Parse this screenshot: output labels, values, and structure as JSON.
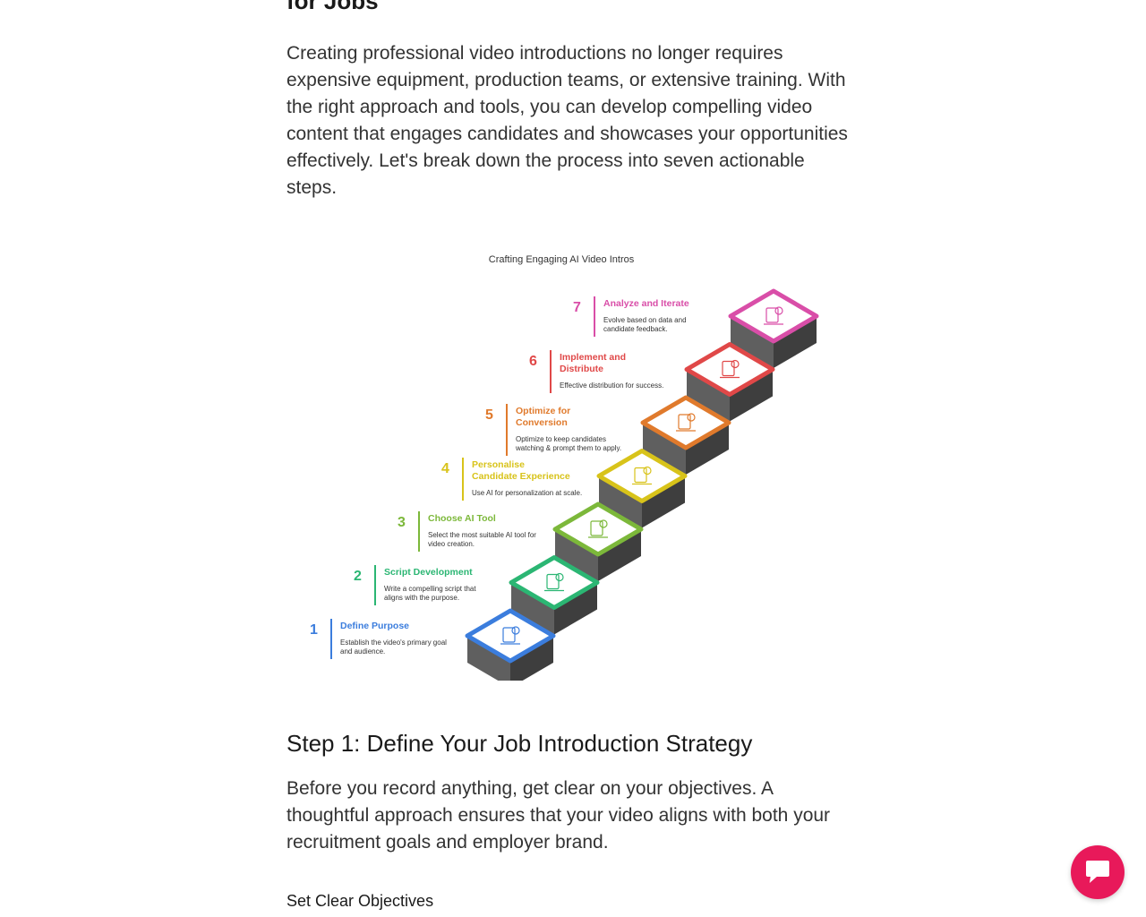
{
  "article": {
    "section_heading": "for Jobs",
    "intro_paragraph": "Creating professional video introductions no longer requires expensive equipment, production teams, or extensive training. With the right approach and tools, you can develop compelling video content that engages candidates and showcases your opportunities effectively. Let's break down the process into seven actionable steps.",
    "infographic": {
      "title": "Crafting Engaging AI Video Intros",
      "steps": [
        {
          "number": "1",
          "title_lines": [
            "Define Purpose"
          ],
          "desc_lines": [
            "Establish the video's primary goal",
            "and audience."
          ],
          "color": "#3b7ddd",
          "icon": "user-target-icon"
        },
        {
          "number": "2",
          "title_lines": [
            "Script Development"
          ],
          "desc_lines": [
            "Write a compelling script that",
            "aligns with the purpose."
          ],
          "color": "#2bb673",
          "icon": "script-file-icon"
        },
        {
          "number": "3",
          "title_lines": [
            "Choose AI Tool"
          ],
          "desc_lines": [
            "Select the most suitable AI tool for",
            "video creation."
          ],
          "color": "#7cb83a",
          "icon": "ai-tool-icon"
        },
        {
          "number": "4",
          "title_lines": [
            "Personalise",
            "Candidate Experience"
          ],
          "desc_lines": [
            "Use AI for personalization at scale."
          ],
          "color": "#d8c31a",
          "icon": "personalise-icon"
        },
        {
          "number": "5",
          "title_lines": [
            "Optimize for",
            "Conversion"
          ],
          "desc_lines": [
            "Optimize to keep candidates",
            "watching & prompt them to apply."
          ],
          "color": "#e07a2c",
          "icon": "optimize-icon"
        },
        {
          "number": "6",
          "title_lines": [
            "Implement and",
            "Distribute"
          ],
          "desc_lines": [
            "Effective distribution for success."
          ],
          "color": "#e04848",
          "icon": "distribute-icon"
        },
        {
          "number": "7",
          "title_lines": [
            "Analyze and Iterate"
          ],
          "desc_lines": [
            "Evolve based on data and",
            "candidate feedback."
          ],
          "color": "#d94ea8",
          "icon": "analyze-check-icon"
        }
      ]
    },
    "step1_heading": "Step 1: Define Your Job Introduction Strategy",
    "step1_paragraph": "Before you record anything, get clear on your objectives. A thoughtful approach ensures that your video aligns with both your recruitment goals and employer brand.",
    "sub_heading": "Set Clear Objectives"
  },
  "chat": {
    "icon": "chat-bubble-icon",
    "color": "#e8195a"
  }
}
